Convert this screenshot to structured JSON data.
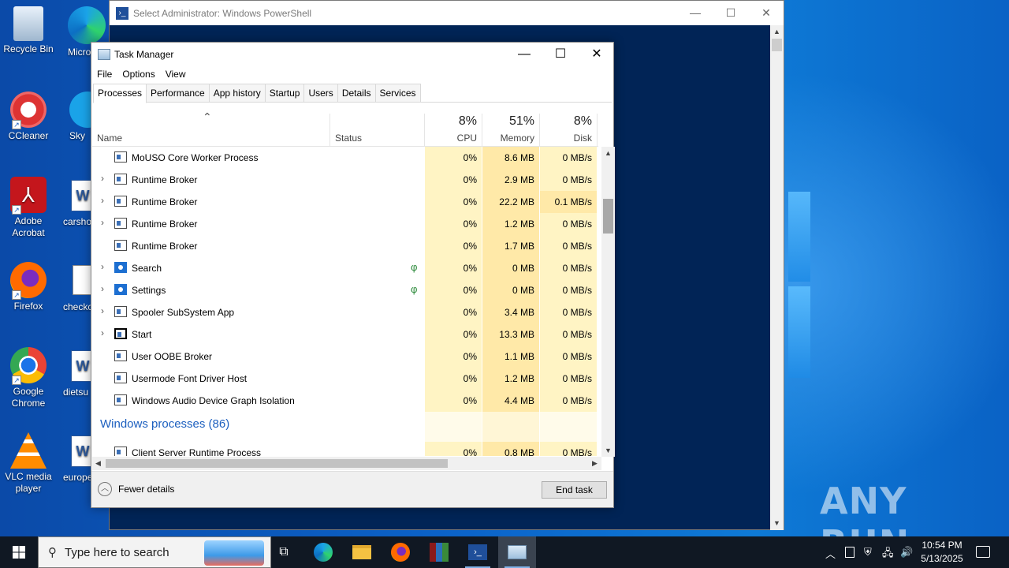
{
  "desktop": {
    "icons": [
      {
        "label": "Recycle Bin"
      },
      {
        "label": "Micro Ed"
      },
      {
        "label": "CCleaner"
      },
      {
        "label": "Sky"
      },
      {
        "label": "Adobe Acrobat"
      },
      {
        "label": "carsho"
      },
      {
        "label": "Firefox"
      },
      {
        "label": "checkc"
      },
      {
        "label": "Google Chrome"
      },
      {
        "label": "dietsu"
      },
      {
        "label": "VLC media player"
      },
      {
        "label": "europe"
      }
    ]
  },
  "powershell": {
    "title": "Select Administrator: Windows PowerShell"
  },
  "taskmanager": {
    "title": "Task Manager",
    "menu": [
      "File",
      "Options",
      "View"
    ],
    "tabs": [
      "Processes",
      "Performance",
      "App history",
      "Startup",
      "Users",
      "Details",
      "Services"
    ],
    "active_tab": "Processes",
    "columns": {
      "name": "Name",
      "status": "Status",
      "cpu": {
        "label": "CPU",
        "pct": "8%"
      },
      "memory": {
        "label": "Memory",
        "pct": "51%"
      },
      "disk": {
        "label": "Disk",
        "pct": "8%"
      }
    },
    "processes": [
      {
        "name": "MoUSO Core Worker Process",
        "expandable": false,
        "cpu": "0%",
        "memory": "8.6 MB",
        "disk": "0 MB/s"
      },
      {
        "name": "Runtime Broker",
        "expandable": true,
        "cpu": "0%",
        "memory": "2.9 MB",
        "disk": "0 MB/s"
      },
      {
        "name": "Runtime Broker",
        "expandable": true,
        "cpu": "0%",
        "memory": "22.2 MB",
        "disk": "0.1 MB/s"
      },
      {
        "name": "Runtime Broker",
        "expandable": true,
        "cpu": "0%",
        "memory": "1.2 MB",
        "disk": "0 MB/s"
      },
      {
        "name": "Runtime Broker",
        "expandable": false,
        "cpu": "0%",
        "memory": "1.7 MB",
        "disk": "0 MB/s"
      },
      {
        "name": "Search",
        "expandable": true,
        "suspended": true,
        "cpu": "0%",
        "memory": "0 MB",
        "disk": "0 MB/s"
      },
      {
        "name": "Settings",
        "expandable": true,
        "suspended": true,
        "cpu": "0%",
        "memory": "0 MB",
        "disk": "0 MB/s"
      },
      {
        "name": "Spooler SubSystem App",
        "expandable": true,
        "cpu": "0%",
        "memory": "3.4 MB",
        "disk": "0 MB/s"
      },
      {
        "name": "Start",
        "expandable": true,
        "cpu": "0%",
        "memory": "13.3 MB",
        "disk": "0 MB/s"
      },
      {
        "name": "User OOBE Broker",
        "expandable": false,
        "cpu": "0%",
        "memory": "1.1 MB",
        "disk": "0 MB/s"
      },
      {
        "name": "Usermode Font Driver Host",
        "expandable": false,
        "cpu": "0%",
        "memory": "1.2 MB",
        "disk": "0 MB/s"
      },
      {
        "name": "Windows Audio Device Graph Isolation",
        "expandable": false,
        "cpu": "0%",
        "memory": "4.4 MB",
        "disk": "0 MB/s"
      }
    ],
    "group": {
      "title": "Windows processes (86)"
    },
    "group_processes": [
      {
        "name": "Client Server Runtime Process",
        "expandable": false,
        "cpu": "0%",
        "memory": "0.8 MB",
        "disk": "0 MB/s"
      }
    ],
    "footer": {
      "fewer_details": "Fewer details",
      "end_task": "End task"
    }
  },
  "taskbar": {
    "search_placeholder": "Type here to search",
    "clock_time": "10:54 PM",
    "clock_date": "5/13/2025"
  },
  "watermark": "ANY RUN"
}
